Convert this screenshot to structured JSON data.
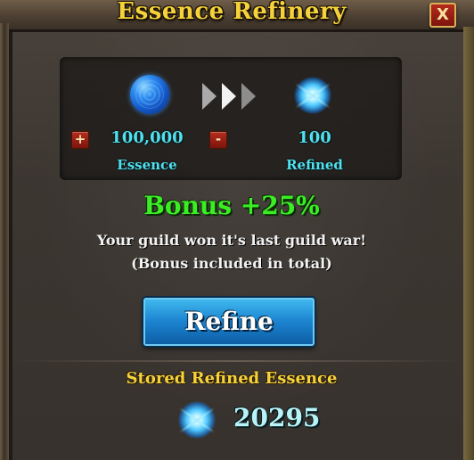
{
  "window": {
    "title": "Essence Refinery",
    "close_label": "X"
  },
  "converter": {
    "plus_label": "+",
    "minus_label": "-",
    "essence_amount": "100,000",
    "essence_label": "Essence",
    "refined_amount": "100",
    "refined_label": "Refined"
  },
  "bonus": {
    "text": "Bonus +25%",
    "line1": "Your guild won it's last guild war!",
    "line2": "(Bonus included in total)"
  },
  "actions": {
    "refine_label": "Refine"
  },
  "stored": {
    "label": "Stored Refined Essence",
    "value": "20295"
  },
  "icons": {
    "essence": "essence-orb-icon",
    "refined": "refined-essence-icon",
    "arrows": "convert-arrows-icon"
  },
  "colors": {
    "title": "#f5d23a",
    "cyan_text": "#4fe0ee",
    "bonus_green": "#3bee24",
    "refine_button": "#1c83cf",
    "close_button": "#b52a1c"
  }
}
